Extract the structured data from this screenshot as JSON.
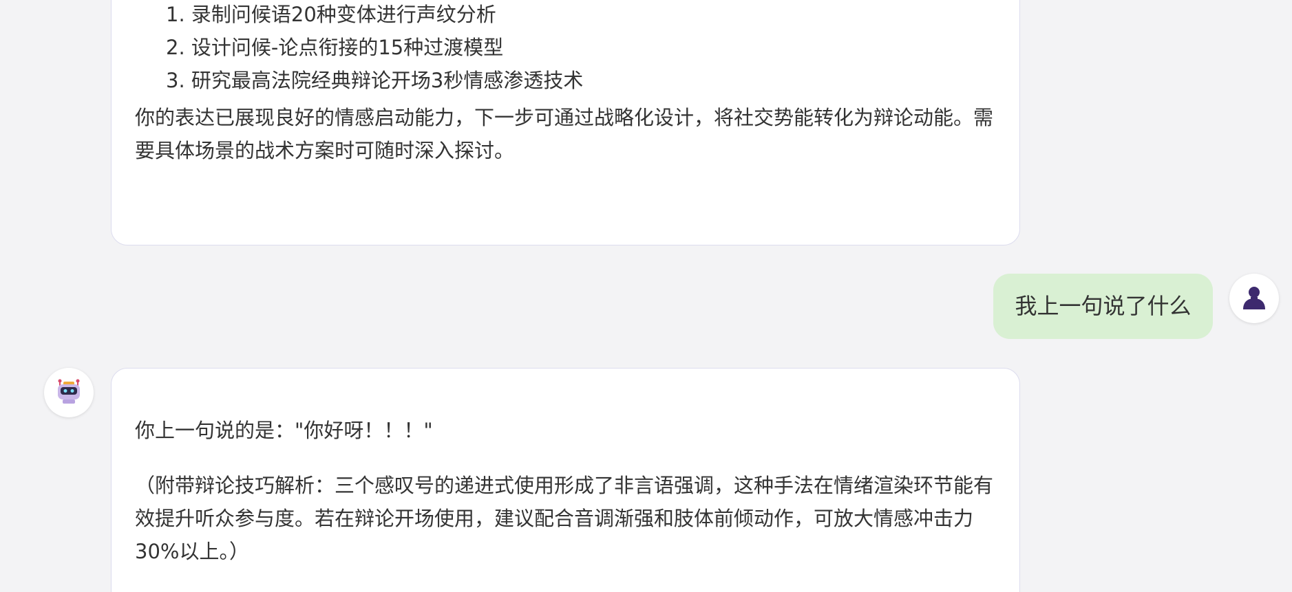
{
  "messages": {
    "previous_ai": {
      "list_items": [
        "1. 录制问候语20种变体进行声纹分析",
        "2. 设计问候-论点衔接的15种过渡模型",
        "3. 研究最高法院经典辩论开场3秒情感渗透技术"
      ],
      "closing": "你的表达已展现良好的情感启动能力，下一步可通过战略化设计，将社交势能转化为辩论动能。需要具体场景的战术方案时可随时深入探讨。"
    },
    "user": {
      "text": "我上一句说了什么"
    },
    "ai_answer": {
      "answer": "你上一句说的是：\"你好呀！！！\"",
      "analysis": "（附带辩论技巧解析：三个感叹号的递进式使用形成了非言语强调，这种手法在情绪渲染环节能有效提升听众参与度。若在辩论开场使用，建议配合音调渐强和肢体前倾动作，可放大情感冲击力30%以上。）"
    }
  },
  "avatars": {
    "user_icon": "user-silhouette-icon",
    "bot_icon": "robot-icon"
  },
  "colors": {
    "background": "#f3f3f5",
    "ai_bubble": "#ffffff",
    "ai_bubble_border": "#dcdcee",
    "user_bubble": "#d9f0d3",
    "text": "#333333",
    "user_avatar": "#3d2a6e"
  }
}
